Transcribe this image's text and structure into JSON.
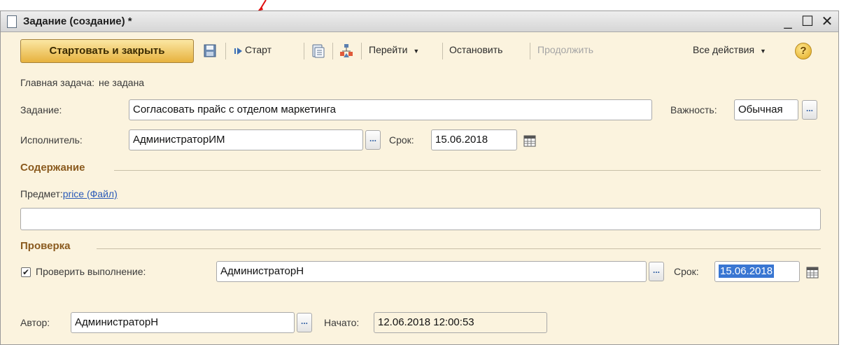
{
  "window": {
    "title": "Задание (создание) *"
  },
  "toolbar": {
    "start_close": "Стартовать и закрыть",
    "start": "Старт",
    "goto": "Перейти",
    "stop": "Остановить",
    "continue": "Продолжить",
    "all_actions": "Все действия",
    "help": "?",
    "icons": [
      "save-icon",
      "start-icon",
      "copy-icon",
      "flow-icon",
      "dropdown-arrow",
      "help-icon"
    ]
  },
  "form": {
    "main_task_label": "Главная задача:",
    "main_task_value": "не задана",
    "task_label": "Задание:",
    "task_value": "Согласовать прайс с отделом маркетинга",
    "importance_label": "Важность:",
    "importance_value": "Обычная",
    "performer_label": "Исполнитель:",
    "performer_value": "АдминистраторИМ",
    "deadline_label": "Срок:",
    "deadline_value": "15.06.2018",
    "content_section": "Содержание",
    "subject_label": "Предмет:",
    "subject_link": "price (Файл)",
    "content_text": "",
    "check_section": "Проверка",
    "check_checked": true,
    "check_label": "Проверить выполнение:",
    "checker_value": "АдминистраторН",
    "check_deadline_label": "Срок:",
    "check_deadline_value": "15.06.2018",
    "author_label": "Автор:",
    "author_value": "АдминистраторН",
    "started_label": "Начато:",
    "started_value": "12.06.2018 12:00:53",
    "ellipsis": "..."
  },
  "colors": {
    "window_bg": "#fbf3de",
    "primary_button": "#e7b23e",
    "section_title": "#8a5a1e",
    "link": "#2a5ab8",
    "selection": "#3976d2",
    "pointer_arrow": "#e01010"
  }
}
